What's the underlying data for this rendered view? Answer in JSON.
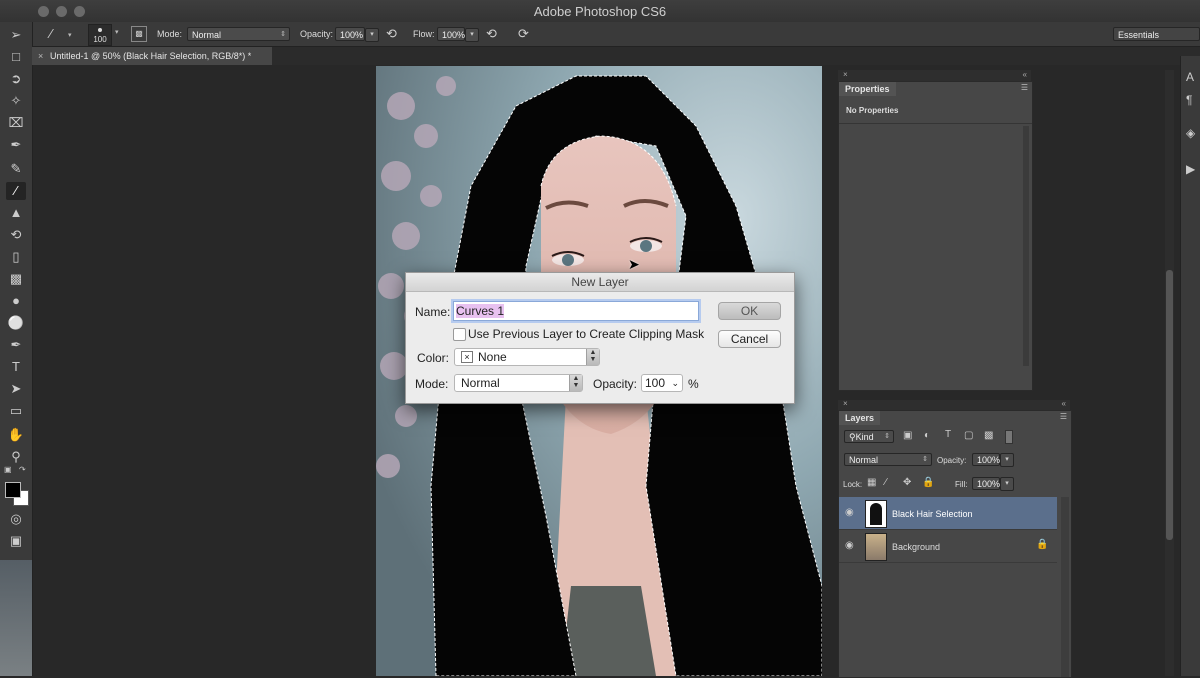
{
  "app": {
    "window_title": "Adobe Photoshop CS6"
  },
  "options_bar": {
    "brush_size": "100",
    "mode_label": "Mode:",
    "mode_value": "Normal",
    "opacity_label": "Opacity:",
    "opacity_value": "100%",
    "flow_label": "Flow:",
    "flow_value": "100%",
    "workspace": "Essentials"
  },
  "document_tab": {
    "label": "Untitled-1 @ 50% (Black Hair Selection, RGB/8*) *"
  },
  "dialog": {
    "title": "New Layer",
    "name_label": "Name:",
    "name_value": "Curves 1",
    "clipping_checkbox": "Use Previous Layer to Create Clipping Mask",
    "clipping_checked": false,
    "color_label": "Color:",
    "color_value": "None",
    "mode_label": "Mode:",
    "mode_value": "Normal",
    "opacity_label": "Opacity:",
    "opacity_value": "100",
    "percent": "%",
    "ok_label": "OK",
    "cancel_label": "Cancel"
  },
  "properties_panel": {
    "tab": "Properties",
    "content": "No Properties"
  },
  "layers_panel": {
    "tab": "Layers",
    "filter_kind": "Kind",
    "blend_mode": "Normal",
    "opacity_label": "Opacity:",
    "opacity_value": "100%",
    "lock_label": "Lock:",
    "fill_label": "Fill:",
    "fill_value": "100%",
    "layers": [
      {
        "name": "Black Hair Selection",
        "selected": true,
        "locked": false
      },
      {
        "name": "Background",
        "selected": false,
        "locked": true
      }
    ]
  },
  "colors": {
    "selection_highlight": "#5b6f8c",
    "name_highlight": "#e8c1f0",
    "panel_bg": "#474747",
    "chrome_bg": "#3a3a3a"
  }
}
